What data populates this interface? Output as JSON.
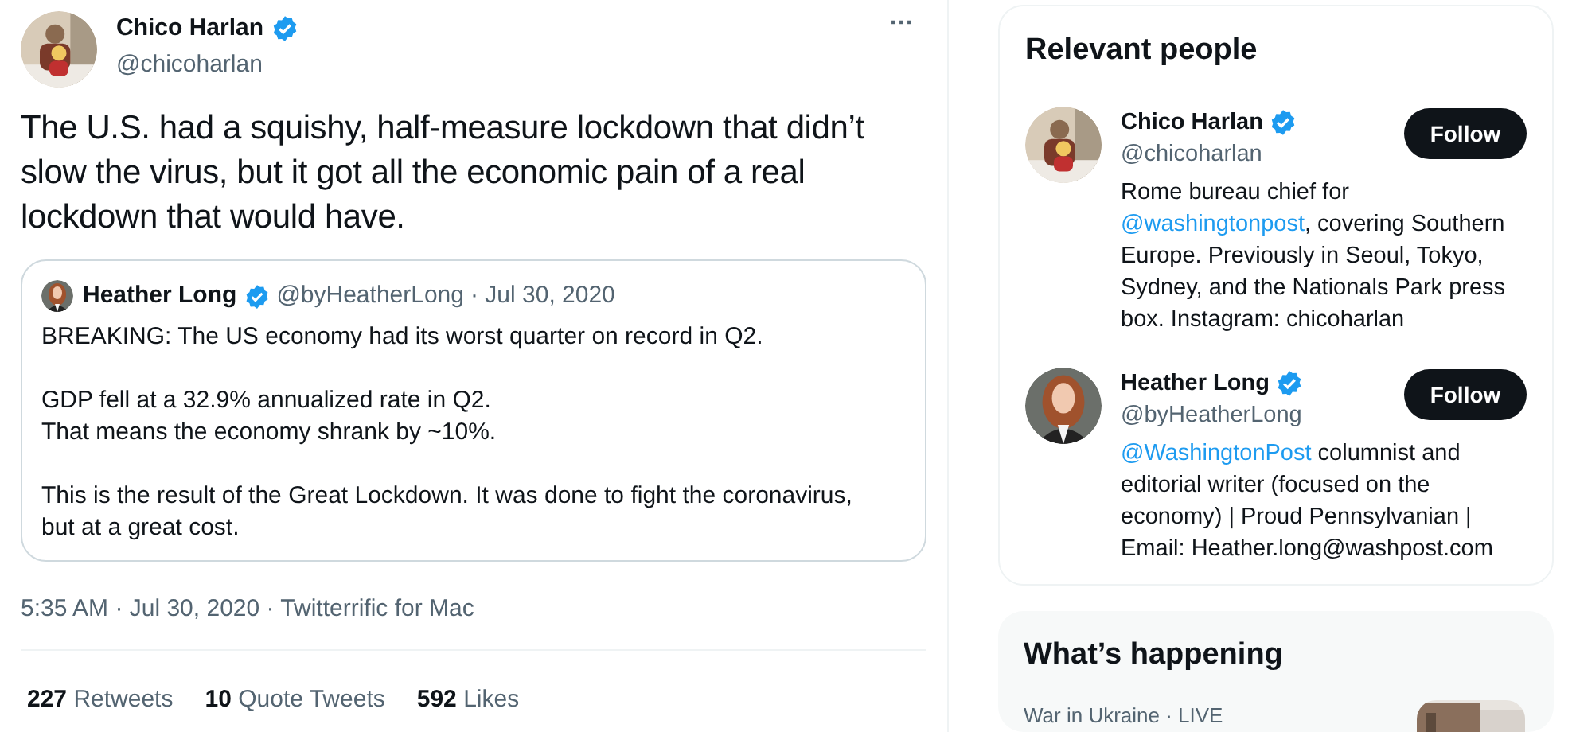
{
  "tweet": {
    "author": {
      "name": "Chico Harlan",
      "handle": "@chicoharlan",
      "verified": true
    },
    "more": "···",
    "text": "The U.S. had a squishy, half-measure lockdown that didn’t slow the virus, but it got all the economic pain of a real lockdown that would have.",
    "quote": {
      "author": {
        "name": "Heather Long",
        "handle": "@byHeatherLong",
        "verified": true
      },
      "date": "· Jul 30, 2020",
      "paragraphs": [
        [
          "BREAKING: The US economy had its worst quarter on record in Q2."
        ],
        [
          "GDP fell at a 32.9% annualized rate in Q2.",
          "That means the economy shrank by ~10%."
        ],
        [
          "This is the result of the Great Lockdown. It was done to fight the coronavirus, but at a great cost."
        ]
      ]
    },
    "meta": "5:35 AM · Jul 30, 2020 · Twitterrific for Mac",
    "stats": [
      "**227** Retweets",
      "**10** Quote Tweets",
      "**592** Likes"
    ]
  },
  "relevant_people": {
    "title": "Relevant people",
    "people": [
      {
        "name": "Chico Harlan",
        "handle": "@chicoharlan",
        "verified": true,
        "button": "Follow",
        "bio": [
          {
            "text": "Rome bureau chief for ",
            "link": false
          },
          {
            "text": "@washingtonpost",
            "link": true
          },
          {
            "text": ", covering Southern Europe. Previously in Seoul, Tokyo, Sydney, and the Nationals Park press box. Instagram: chicoharlan",
            "link": false
          }
        ]
      },
      {
        "name": "Heather Long",
        "handle": "@byHeatherLong",
        "verified": true,
        "button": "Follow",
        "bio": [
          {
            "text": "@WashingtonPost",
            "link": true
          },
          {
            "text": " columnist and editorial writer (focused on the economy) | Proud Pennsylvanian | Email: Heather.long@washpost.com",
            "link": false
          }
        ]
      }
    ]
  },
  "whats_happening": {
    "title": "What’s happening",
    "trends": [
      {
        "context": "War in Ukraine · LIVE"
      }
    ]
  }
}
